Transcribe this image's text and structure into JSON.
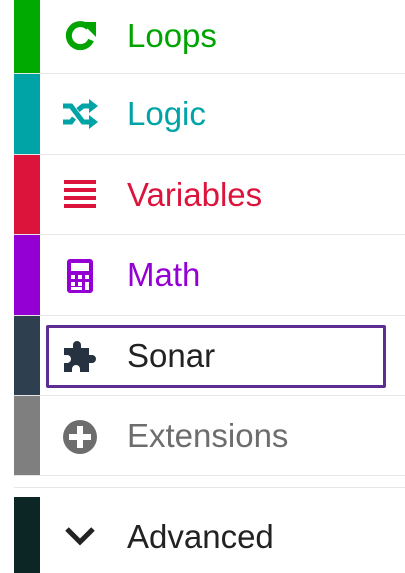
{
  "toolbox": {
    "categories": [
      {
        "id": "loops",
        "label": "Loops",
        "icon": "loops-icon",
        "color": "#00aa00",
        "text_color": "#00a400"
      },
      {
        "id": "logic",
        "label": "Logic",
        "icon": "logic-icon",
        "color": "#00a4a6",
        "text_color": "#00a4a6"
      },
      {
        "id": "variables",
        "label": "Variables",
        "icon": "variables-icon",
        "color": "#dc143c",
        "text_color": "#dc143c"
      },
      {
        "id": "math",
        "label": "Math",
        "icon": "math-icon",
        "color": "#9400d3",
        "text_color": "#9400d3"
      },
      {
        "id": "sonar",
        "label": "Sonar",
        "icon": "puzzle-icon",
        "color": "#2e3f50",
        "text_color": "#222222",
        "selected": true,
        "outline_color": "#5e2d91"
      },
      {
        "id": "extensions",
        "label": "Extensions",
        "icon": "plus-circle-icon",
        "color": "#7f7f7f",
        "text_color": "#6d6d6d"
      },
      {
        "id": "advanced",
        "label": "Advanced",
        "icon": "chevron-down-icon",
        "color": "#0c2525",
        "text_color": "#222222"
      }
    ]
  }
}
